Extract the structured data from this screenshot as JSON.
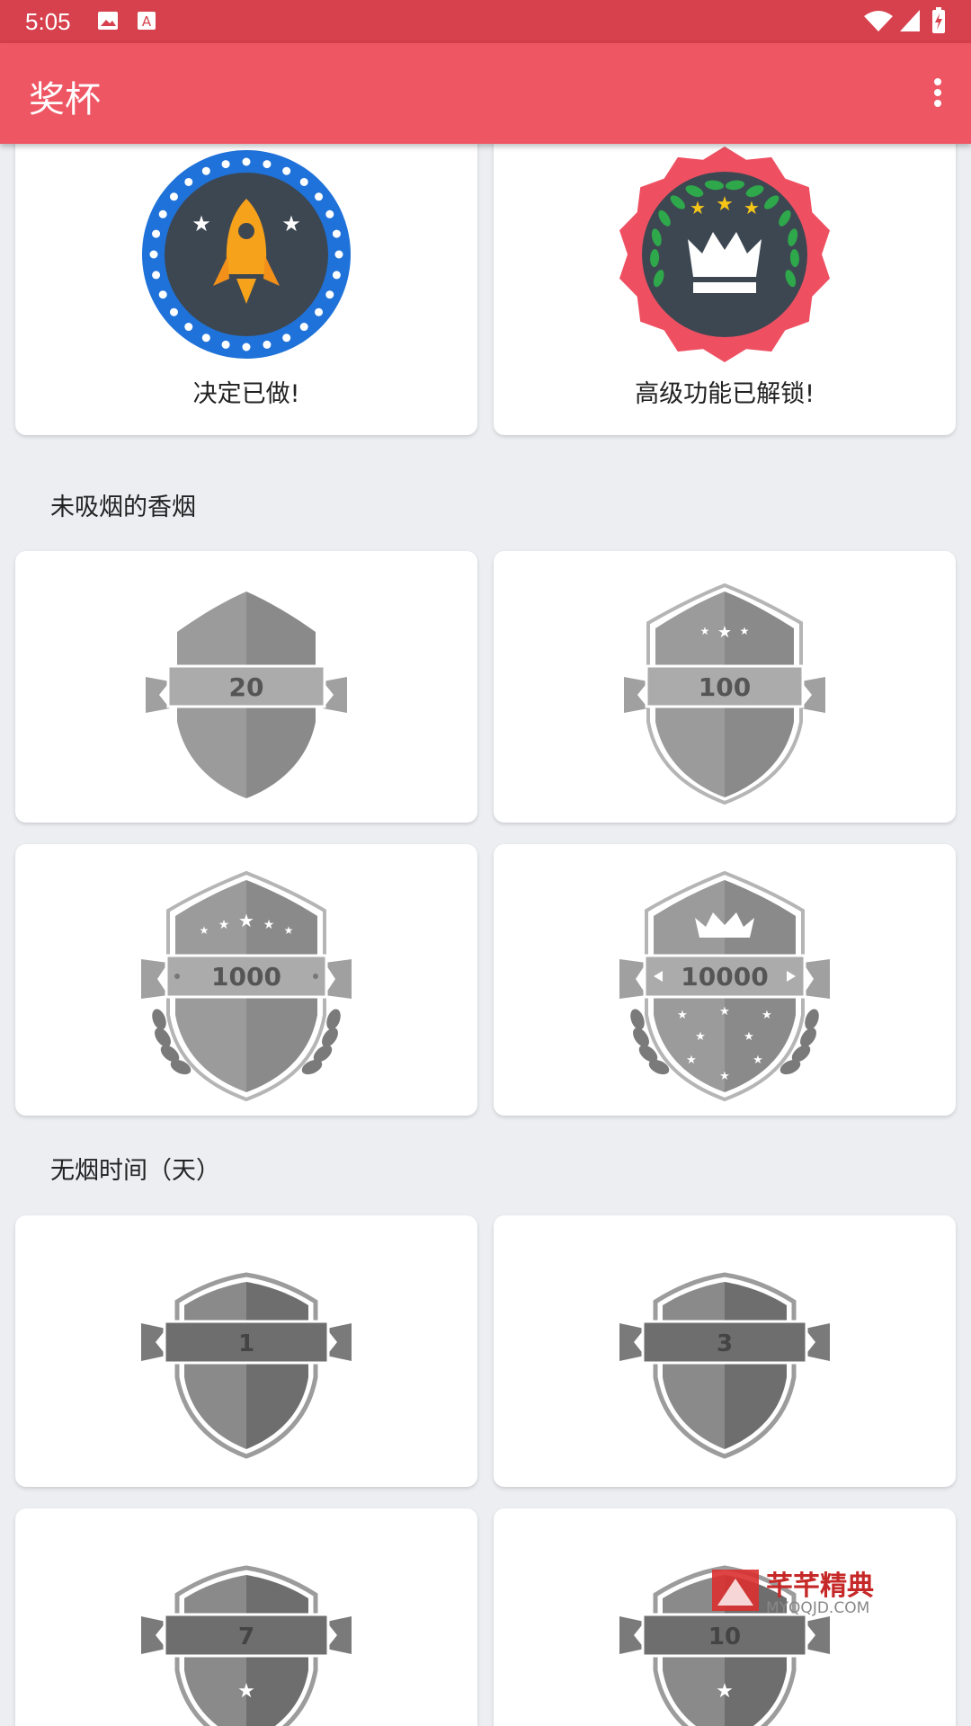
{
  "status_bar": {
    "time": "5:05"
  },
  "app_bar": {
    "title": "奖杯"
  },
  "top_awards": [
    {
      "label": "决定已做!"
    },
    {
      "label": "高级功能已解锁!"
    }
  ],
  "sections": [
    {
      "title": "未吸烟的香烟",
      "badges": [
        "20",
        "100",
        "1000",
        "10000"
      ]
    },
    {
      "title": "无烟时间（天）",
      "badges": [
        "1",
        "3",
        "7",
        "10"
      ]
    }
  ],
  "watermark": {
    "name": "芊芊精典",
    "url": "MYQQJD.COM"
  },
  "colors": {
    "status_bar": "#d7404d",
    "app_bar": "#ef5664",
    "background": "#eceef2"
  }
}
